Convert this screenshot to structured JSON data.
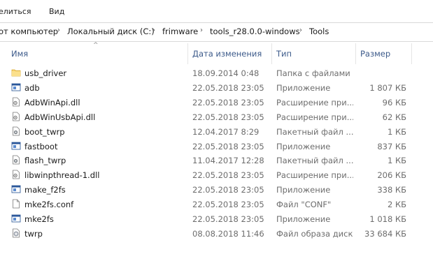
{
  "menu": {
    "share_label": "елиться",
    "view_label": "Вид"
  },
  "breadcrumb": {
    "items": [
      "от компьютер",
      "Локальный диск (C:)",
      "frimware",
      "tools_r28.0.0-windows",
      "Tools"
    ]
  },
  "columns": {
    "name": "Имя",
    "date": "Дата изменения",
    "type": "Тип",
    "size": "Размер"
  },
  "files": [
    {
      "name": "usb_driver",
      "date": "18.09.2014 0:48",
      "type": "Папка с файлами",
      "size": "",
      "icon": "folder-icon"
    },
    {
      "name": "adb",
      "date": "22.05.2018 23:05",
      "type": "Приложение",
      "size": "1 807 КБ",
      "icon": "application-icon"
    },
    {
      "name": "AdbWinApi.dll",
      "date": "22.05.2018 23:05",
      "type": "Расширение при...",
      "size": "96 КБ",
      "icon": "dll-icon"
    },
    {
      "name": "AdbWinUsbApi.dll",
      "date": "22.05.2018 23:05",
      "type": "Расширение при...",
      "size": "62 КБ",
      "icon": "dll-icon"
    },
    {
      "name": "boot_twrp",
      "date": "12.04.2017 8:29",
      "type": "Пакетный файл ...",
      "size": "1 КБ",
      "icon": "batch-file-icon"
    },
    {
      "name": "fastboot",
      "date": "22.05.2018 23:05",
      "type": "Приложение",
      "size": "837 КБ",
      "icon": "application-icon"
    },
    {
      "name": "flash_twrp",
      "date": "11.04.2017 12:28",
      "type": "Пакетный файл ...",
      "size": "1 КБ",
      "icon": "batch-file-icon"
    },
    {
      "name": "libwinpthread-1.dll",
      "date": "22.05.2018 23:05",
      "type": "Расширение при...",
      "size": "206 КБ",
      "icon": "dll-icon"
    },
    {
      "name": "make_f2fs",
      "date": "22.05.2018 23:05",
      "type": "Приложение",
      "size": "338 КБ",
      "icon": "application-icon"
    },
    {
      "name": "mke2fs.conf",
      "date": "22.05.2018 23:05",
      "type": "Файл \"CONF\"",
      "size": "2 КБ",
      "icon": "file-icon"
    },
    {
      "name": "mke2fs",
      "date": "22.05.2018 23:05",
      "type": "Приложение",
      "size": "1 018 КБ",
      "icon": "application-icon"
    },
    {
      "name": "twrp",
      "date": "08.08.2018 11:46",
      "type": "Файл образа диска",
      "size": "33 684 КБ",
      "icon": "disk-image-icon"
    }
  ]
}
